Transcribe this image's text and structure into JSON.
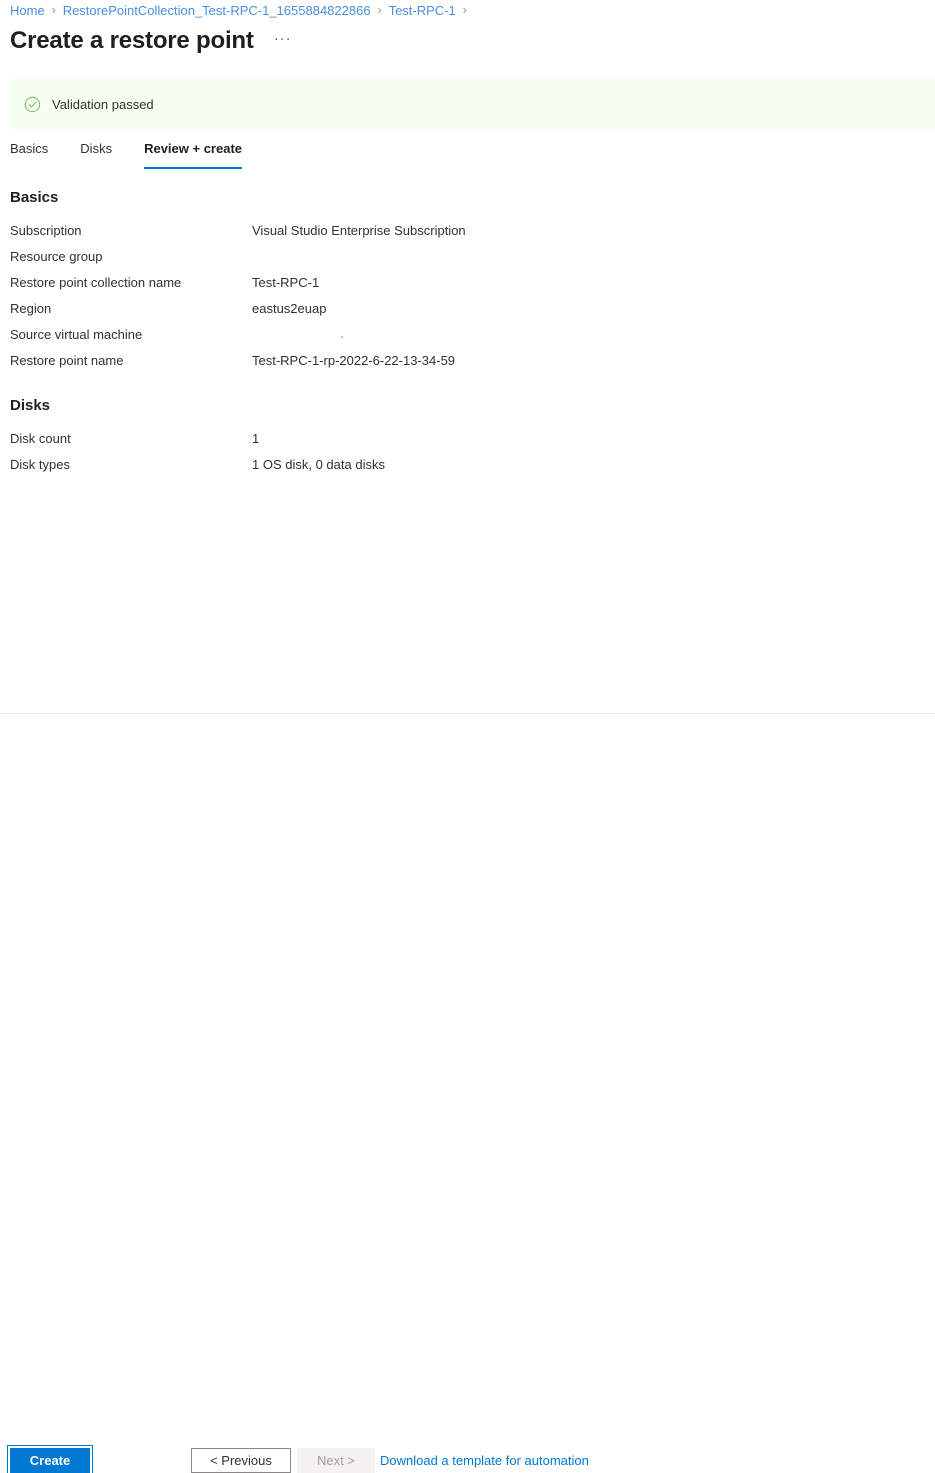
{
  "breadcrumb": {
    "separator": "›",
    "items": [
      {
        "label": "Home"
      },
      {
        "label": "RestorePointCollection_Test-RPC-1_1655884822866"
      },
      {
        "label": "Test-RPC-1"
      }
    ],
    "trailing_separator": "›"
  },
  "header": {
    "title": "Create a restore point",
    "more_actions": "···"
  },
  "validation": {
    "icon": "check-circle-icon",
    "message": "Validation passed",
    "background_color": "#f6fff0",
    "icon_color": "#7ab85c"
  },
  "tabs": [
    {
      "label": "Basics",
      "active": false
    },
    {
      "label": "Disks",
      "active": false
    },
    {
      "label": "Review + create",
      "active": true
    }
  ],
  "sections": [
    {
      "title": "Basics",
      "rows": [
        {
          "key": "Subscription",
          "value": "Visual Studio Enterprise Subscription"
        },
        {
          "key": "Resource group",
          "value": ""
        },
        {
          "key": "Restore point collection name",
          "value": "Test-RPC-1"
        },
        {
          "key": "Region",
          "value": "eastus2euap"
        },
        {
          "key": "Source virtual machine",
          "value": ""
        },
        {
          "key": "Restore point name",
          "value": "Test-RPC-1-rp-2022-6-22-13-34-59"
        }
      ]
    },
    {
      "title": "Disks",
      "rows": [
        {
          "key": "Disk count",
          "value": "1"
        },
        {
          "key": "Disk types",
          "value": "1 OS disk, 0 data disks"
        }
      ]
    }
  ],
  "footer": {
    "create_label": "Create",
    "previous_label": "< Previous",
    "next_label": "Next >",
    "next_disabled": true,
    "download_template_label": "Download a template for automation",
    "accent_color": "#0078d4",
    "link_color": "#0078d4"
  }
}
